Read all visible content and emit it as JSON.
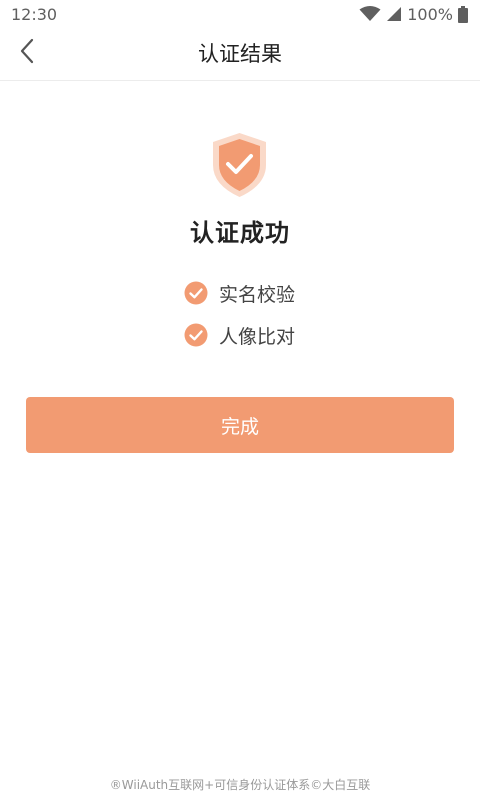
{
  "status_bar": {
    "time": "12:30",
    "battery_text": "100%",
    "icons": [
      "wifi-icon",
      "signal-icon",
      "battery-icon"
    ]
  },
  "header": {
    "title": "认证结果",
    "back_icon": "chevron-left-icon"
  },
  "result": {
    "icon": "shield-check-icon",
    "title": "认证成功",
    "checks": [
      {
        "label": "实名校验",
        "icon": "check-circle-icon"
      },
      {
        "label": "人像比对",
        "icon": "check-circle-icon"
      }
    ]
  },
  "actions": {
    "done_label": "完成"
  },
  "footer": {
    "text": "®WiiAuth互联网+可信身份认证体系©大白互联"
  },
  "colors": {
    "accent": "#F29B72",
    "accent_light": "#FAD9C8",
    "title_text": "#222222",
    "footer_text": "#999999"
  }
}
